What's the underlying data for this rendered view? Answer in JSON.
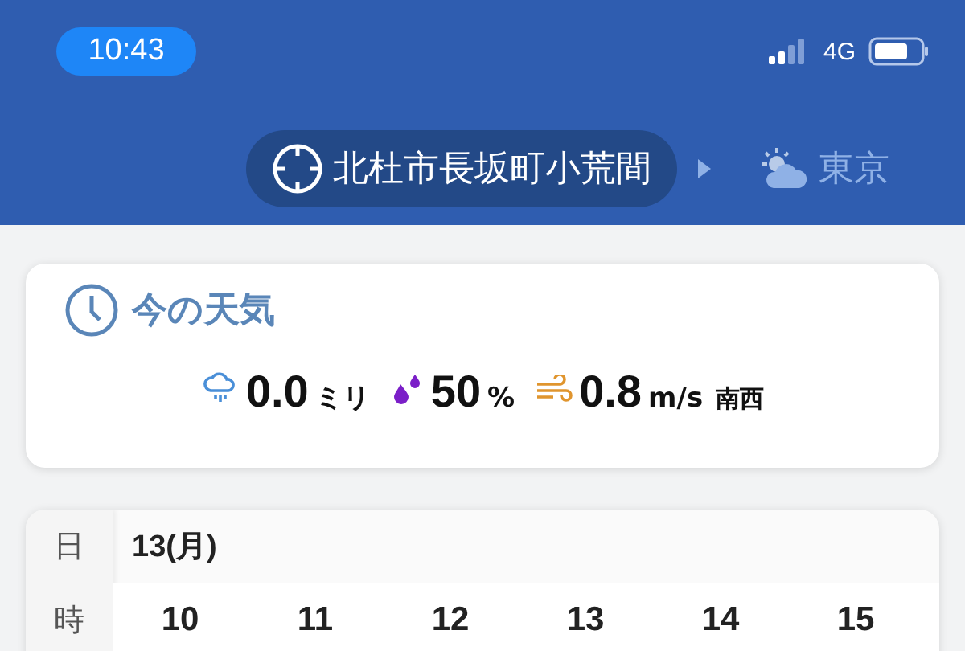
{
  "status_bar": {
    "time": "10:43",
    "network": "4G"
  },
  "locations": [
    {
      "name": "北杜市長坂町小荒間",
      "selected": true,
      "kind": "current"
    },
    {
      "name": "東京",
      "selected": false,
      "kind": "weather"
    }
  ],
  "current_weather": {
    "title": "今の天気",
    "items": [
      {
        "kind": "rain",
        "value": "0.0",
        "unit": "ミリ"
      },
      {
        "kind": "humidity",
        "value": "50",
        "unit": "%"
      },
      {
        "kind": "wind",
        "value": "0.8",
        "unit": "m/s",
        "direction": "南西"
      }
    ]
  },
  "forecast": {
    "day_label": "日",
    "hour_label": "時",
    "date": "13(月)",
    "hours": [
      "10",
      "11",
      "12",
      "13",
      "14",
      "15"
    ]
  }
}
